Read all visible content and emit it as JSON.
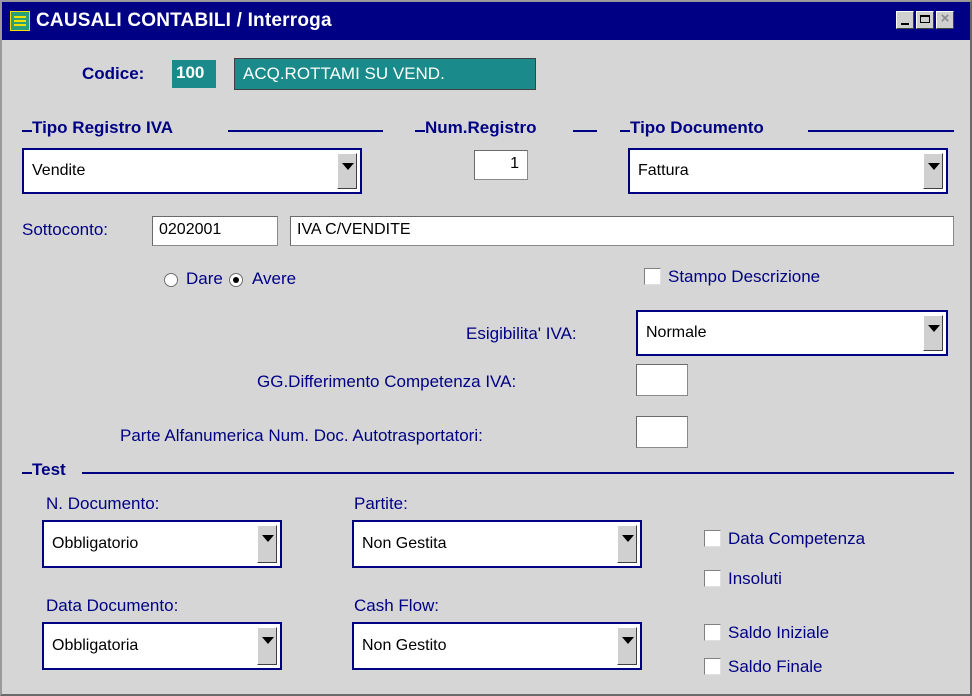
{
  "window": {
    "title": "CAUSALI CONTABILI / Interroga"
  },
  "codice": {
    "label": "Codice:",
    "value": "100",
    "description": "ACQ.ROTTAMI SU VEND."
  },
  "tipo_registro_iva": {
    "title": "Tipo Registro IVA",
    "value": "Vendite"
  },
  "num_registro": {
    "title": "Num.Registro",
    "value": "1"
  },
  "tipo_documento": {
    "title": "Tipo Documento",
    "value": "Fattura"
  },
  "sottoconto": {
    "label": "Sottoconto:",
    "code": "0202001",
    "description": "IVA C/VENDITE"
  },
  "dare_avere": {
    "dare_label": "Dare",
    "avere_label": "Avere",
    "selected": "Avere"
  },
  "stampo_descrizione": {
    "label": "Stampo Descrizione",
    "checked": false
  },
  "esigibilita_iva": {
    "label": "Esigibilita' IVA:",
    "value": "Normale"
  },
  "gg_differimento": {
    "label": "GG.Differimento Competenza IVA:",
    "value": ""
  },
  "parte_alfanumerica": {
    "label": "Parte Alfanumerica Num. Doc. Autotrasportatori:",
    "value": ""
  },
  "test": {
    "title": "Test",
    "n_documento": {
      "label": "N. Documento:",
      "value": "Obbligatorio"
    },
    "partite": {
      "label": "Partite:",
      "value": "Non Gestita"
    },
    "data_documento": {
      "label": "Data Documento:",
      "value": "Obbligatoria"
    },
    "cash_flow": {
      "label": "Cash Flow:",
      "value": "Non Gestito"
    },
    "checkboxes": [
      {
        "label": "Data Competenza",
        "checked": false
      },
      {
        "label": "Insoluti",
        "checked": false
      },
      {
        "label": "Saldo Iniziale",
        "checked": false
      },
      {
        "label": "Saldo Finale",
        "checked": false
      }
    ]
  }
}
